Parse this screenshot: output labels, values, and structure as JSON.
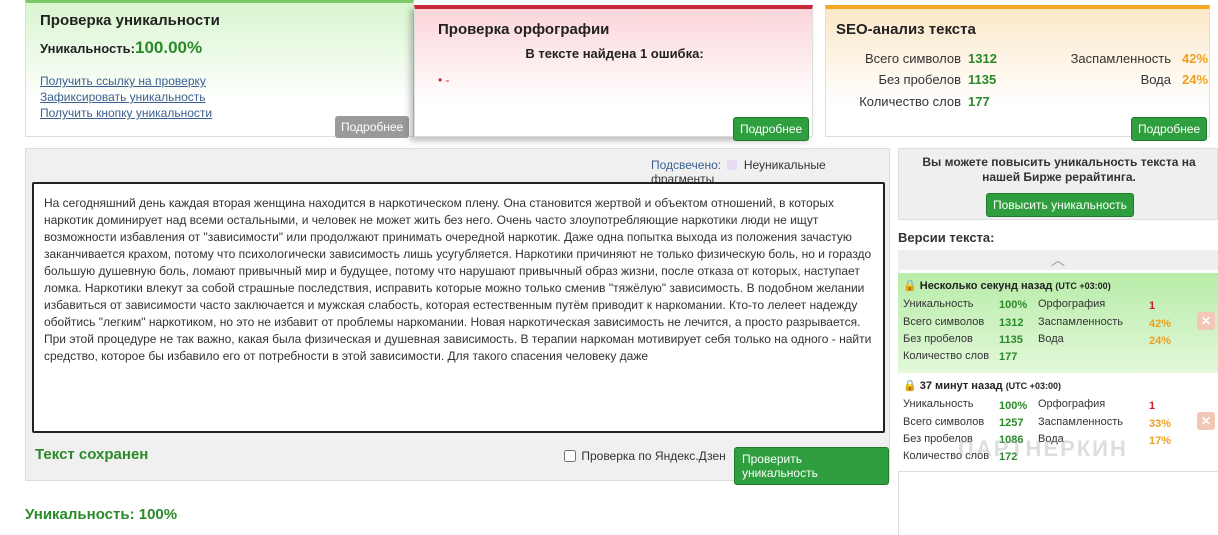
{
  "uniqueness_panel": {
    "title": "Проверка уникальности",
    "label": "Уникальность:",
    "value": "100.00%",
    "links": [
      "Получить ссылку на проверку",
      "Зафиксировать уникальность",
      "Получить кнопку уникальности"
    ],
    "more_button": "Подробнее"
  },
  "spelling_panel": {
    "title": "Проверка орфографии",
    "found": "В тексте найдена 1 ошибка:",
    "error_item": "-",
    "more_button": "Подробнее"
  },
  "seo_panel": {
    "title": "SEO-анализ текста",
    "total_chars_label": "Всего символов",
    "total_chars": "1312",
    "no_spaces_label": "Без пробелов",
    "no_spaces": "1135",
    "words_label": "Количество слов",
    "words": "177",
    "spam_label": "Заспамленность",
    "spam": "42%",
    "water_label": "Вода",
    "water": "24%",
    "more_button": "Подробнее"
  },
  "editor": {
    "highlight_label": "Подсвечено:",
    "highlight_legend": "Неуникальные фрагменты",
    "text": "На сегодняшний день каждая вторая женщина находится в наркотическом плену. Она становится жертвой и объектом отношений, в которых наркотик доминирует над всеми остальными, и человек не может жить без него. Очень часто злоупотребляющие наркотики люди не ищут возможности избавления от \"зависимости\" или продолжают принимать очередной наркотик. Даже одна попытка выхода из положения зачастую заканчивается крахом, потому что психологически зависимость лишь усугубляется. Наркотики причиняют не только физическую боль, но и гораздо большую душевную боль, ломают привычный мир и будущее, потому что нарушают привычный образ жизни, после отказа от которых, наступает ломка. Наркотики влекут за собой страшные последствия, исправить которые можно только сменив \"тяжёлую\" зависимость. В подобном желании избавиться от зависимости часто заключается и мужская слабость, которая естественным путём приводит к наркомании. Кто-то лелеет надежду обойтись \"легким\" наркотиком, но это не избавит от проблемы наркомании. Новая наркотическая зависимость не лечится, а просто разрывается. При этой процедуре не так важно, какая была физическая и душевная зависимость. В терапии наркоман мотивирует себя только на одного - найти средство, которое бы избавило его от потребности в этой зависимости. Для такого спасения человеку даже",
    "saved_status": "Текст сохранен",
    "yandex_checkbox": "Проверка по Яндекс.Дзен",
    "check_button": "Проверить уникальность"
  },
  "bottom_result": "Уникальность: 100%",
  "side": {
    "promo_text": "Вы можете повысить уникальность текста на нашей Бирже рерайтинга.",
    "promo_button": "Повысить уникальность",
    "versions_title": "Версии текста:",
    "versions": [
      {
        "time": "Несколько секунд назад",
        "tz": "(UTC +03:00)",
        "uniq_label": "Уникальность",
        "uniq": "100%",
        "chars_label": "Всего символов",
        "chars": "1312",
        "nospace_label": "Без пробелов",
        "nospace": "1135",
        "words_label": "Количество слов",
        "words": "177",
        "spell_label": "Орфография",
        "spell": "1",
        "spam_label": "Заспамленность",
        "spam": "42%",
        "water_label": "Вода",
        "water": "24%"
      },
      {
        "time": "37 минут назад",
        "tz": "(UTC +03:00)",
        "uniq_label": "Уникальность",
        "uniq": "100%",
        "chars_label": "Всего символов",
        "chars": "1257",
        "nospace_label": "Без пробелов",
        "nospace": "1086",
        "words_label": "Количество слов",
        "words": "172",
        "spell_label": "Орфография",
        "spell": "1",
        "spam_label": "Заспамленность",
        "spam": "33%",
        "water_label": "Вода",
        "water": "17%"
      }
    ],
    "watermark": "ПАРТНЕРКИН"
  },
  "colors": {
    "accent_green": "#2e9e3e",
    "red": "#c8283a",
    "orange": "#f5a623"
  }
}
